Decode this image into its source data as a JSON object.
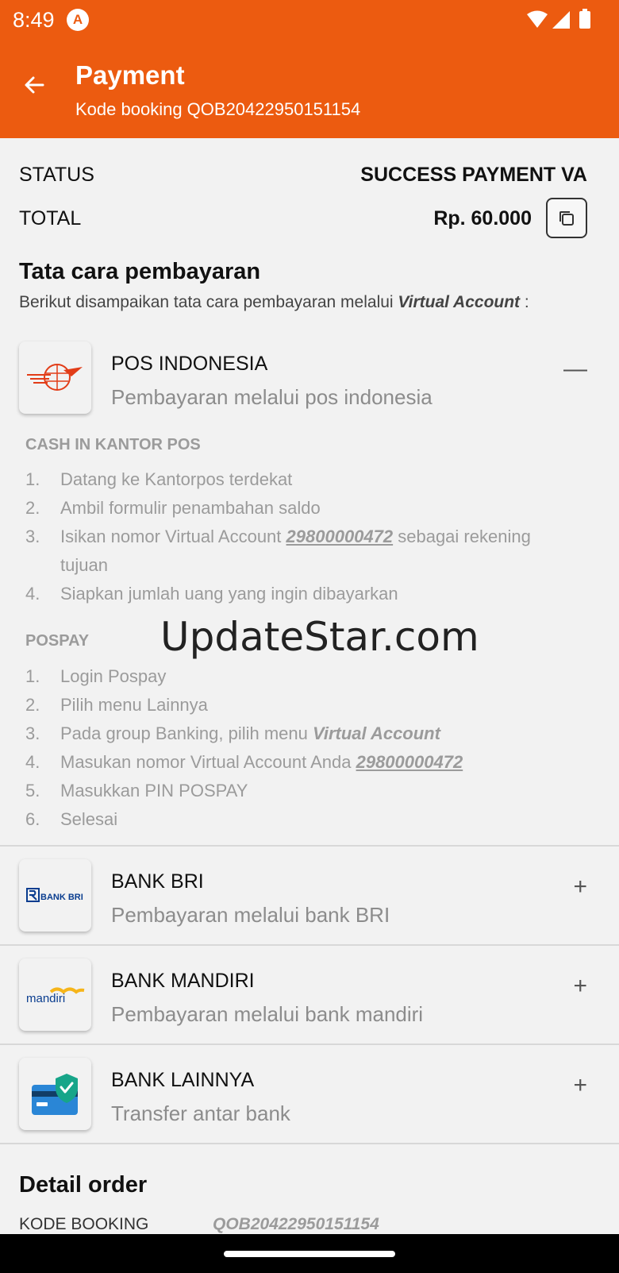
{
  "status_bar": {
    "time": "8:49",
    "app_icon": "A"
  },
  "header": {
    "title": "Payment",
    "subtitle": "Kode booking QOB20422950151154"
  },
  "summary": {
    "status_label": "STATUS",
    "status_value": "SUCCESS PAYMENT VA",
    "total_label": "TOTAL",
    "total_value": "Rp. 60.000"
  },
  "instructions": {
    "title": "Tata cara pembayaran",
    "intro_prefix": "Berikut disampaikan tata cara pembayaran melalui ",
    "intro_emphasis": "Virtual Account",
    "intro_suffix": " :"
  },
  "banks": [
    {
      "name": "POS INDONESIA",
      "desc": "Pembayaran melalui pos indonesia",
      "toggle": "—",
      "logo": "pos-indonesia-logo"
    },
    {
      "name": "BANK BRI",
      "desc": "Pembayaran melalui bank BRI",
      "toggle": "+",
      "logo": "bank-bri-logo",
      "logo_text": "BANK BRI"
    },
    {
      "name": "BANK MANDIRI",
      "desc": "Pembayaran melalui bank mandiri",
      "toggle": "+",
      "logo": "mandiri-logo",
      "logo_text": "mandiri"
    },
    {
      "name": "BANK LAINNYA",
      "desc": "Transfer antar bank",
      "toggle": "+",
      "logo": "card-shield-icon"
    }
  ],
  "pos_details": {
    "cash_title": "CASH IN KANTOR POS",
    "cash_steps": [
      {
        "n": "1.",
        "text": "Datang ke Kantorpos terdekat"
      },
      {
        "n": "2.",
        "text": "Ambil formulir penambahan saldo"
      },
      {
        "n": "3.",
        "text_a": "Isikan nomor Virtual Account ",
        "va": "29800000472",
        "text_b": " sebagai rekening",
        "text_c": "tujuan"
      },
      {
        "n": "4.",
        "text": "Siapkan jumlah uang yang ingin dibayarkan"
      }
    ],
    "pospay_title": "POSPAY",
    "pospay_steps": [
      {
        "n": "1.",
        "text": "Login Pospay"
      },
      {
        "n": "2.",
        "text": "Pilih menu Lainnya"
      },
      {
        "n": "3.",
        "text_a": "Pada group Banking, pilih menu ",
        "em": "Virtual Account"
      },
      {
        "n": "4.",
        "text_a": "Masukan nomor Virtual Account Anda ",
        "va": "29800000472"
      },
      {
        "n": "5.",
        "text": "Masukkan PIN POSPAY"
      },
      {
        "n": "6.",
        "text": "Selesai"
      }
    ]
  },
  "watermark": "UpdateStar.com",
  "detail_order": {
    "title": "Detail order",
    "booking_label": "KODE BOOKING",
    "booking_value": "QOB20422950151154"
  },
  "colors": {
    "brand": "#ec5b10",
    "muted": "#9b9b9b"
  }
}
